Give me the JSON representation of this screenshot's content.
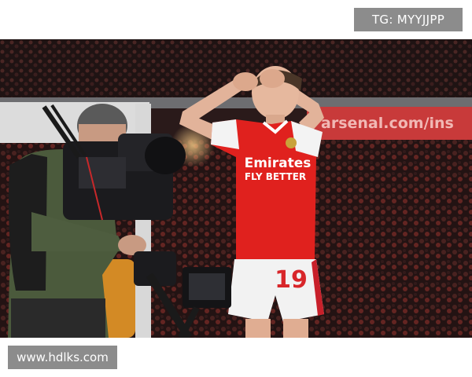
{
  "watermarks": {
    "top_right": "TG: MYYJJPP",
    "bottom_left": "www.hdlks.com"
  },
  "photo": {
    "billboard_text": "arsenal.com/ins",
    "shirt_sponsor_line1": "Emirates",
    "shirt_sponsor_line2": "FLY BETTER",
    "shirt_number": "19",
    "colors": {
      "shirt_red": "#e0211e",
      "shorts_white": "#f2f2f2",
      "billboard_red": "#c83a3a",
      "stand_dark": "#1e1414"
    }
  }
}
